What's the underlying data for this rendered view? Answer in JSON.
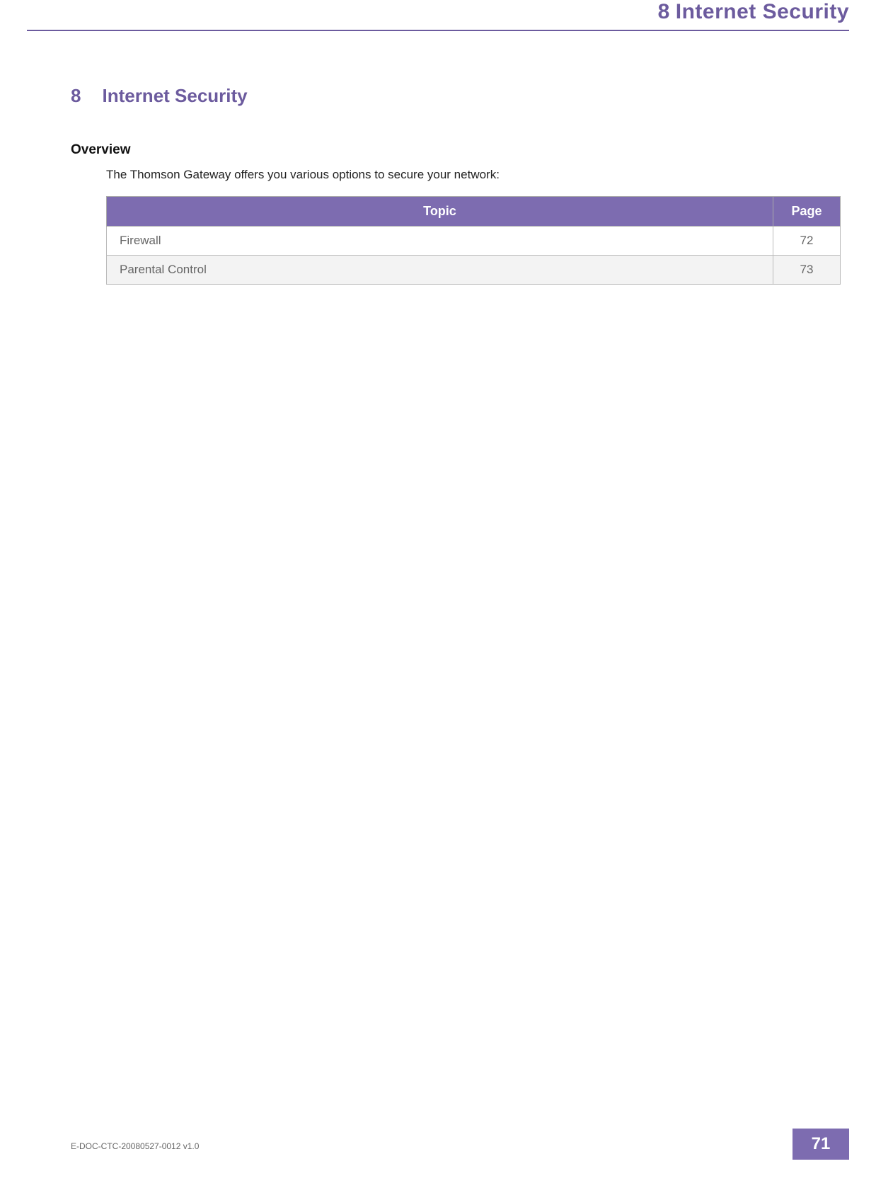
{
  "header": {
    "chapter_num": "8",
    "chapter_title": "Internet Security"
  },
  "section": {
    "num": "8",
    "title": "Internet Security"
  },
  "overview": {
    "heading": "Overview",
    "intro": "The Thomson Gateway offers you various options to secure your network:"
  },
  "table": {
    "col_topic": "Topic",
    "col_page": "Page",
    "rows": [
      {
        "topic": "Firewall",
        "page": "72"
      },
      {
        "topic": "Parental Control",
        "page": "73"
      }
    ]
  },
  "footer": {
    "docid": "E-DOC-CTC-20080527-0012 v1.0",
    "page": "71"
  }
}
